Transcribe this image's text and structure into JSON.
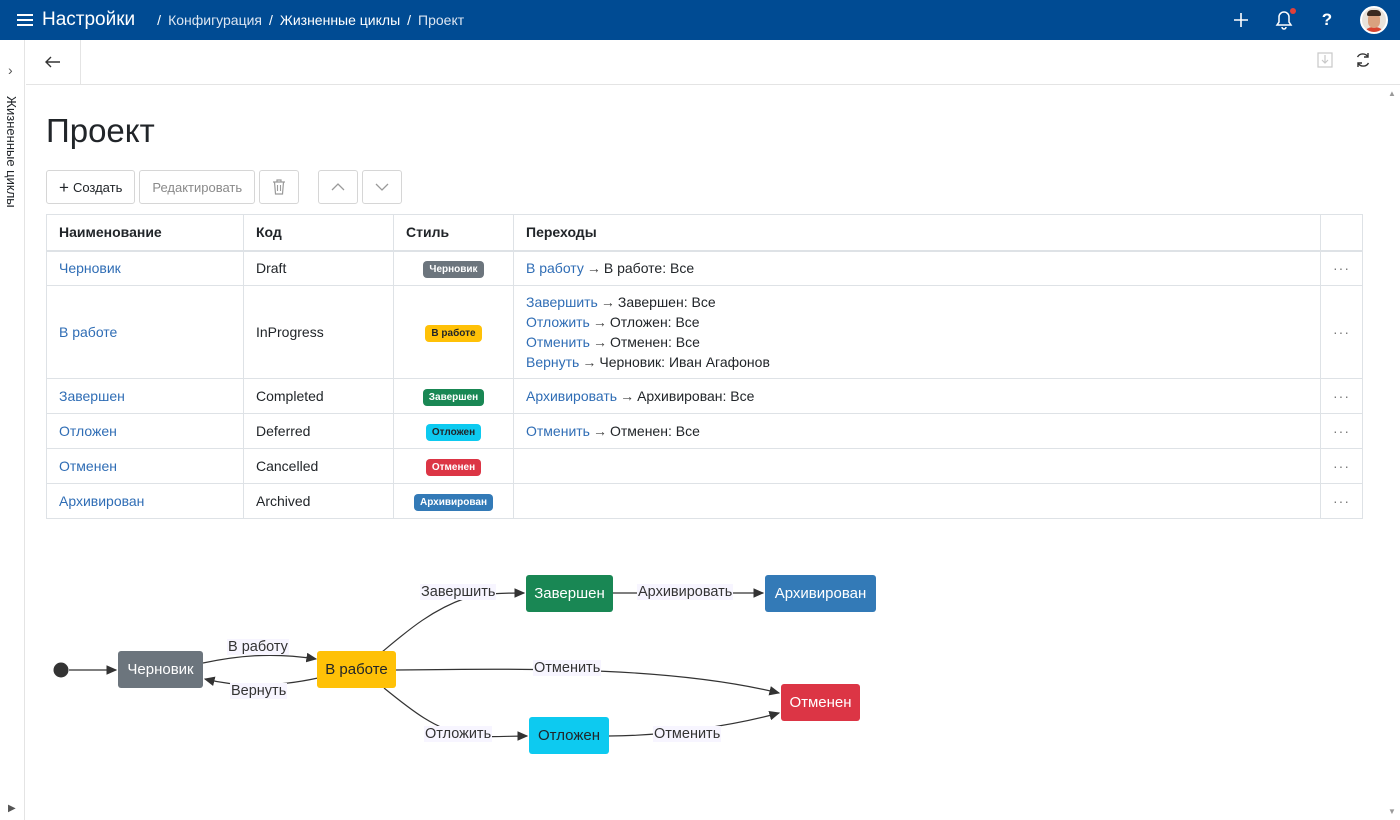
{
  "app": {
    "title": "Настройки"
  },
  "breadcrumbs": [
    "Конфигурация",
    "Жизненные циклы",
    "Проект"
  ],
  "sidebar": {
    "label": "Жизненные циклы"
  },
  "page": {
    "title": "Проект"
  },
  "toolbar": {
    "create": "Создать",
    "edit": "Редактировать"
  },
  "table": {
    "headers": [
      "Наименование",
      "Код",
      "Стиль",
      "Переходы"
    ],
    "rows": [
      {
        "name": "Черновик",
        "code": "Draft",
        "style": "Черновик",
        "style_color": "#6c757d",
        "style_text": "#ffffff",
        "transitions": [
          {
            "action": "В работу",
            "target": "В работе: Все"
          }
        ]
      },
      {
        "name": "В работе",
        "code": "InProgress",
        "style": "В работе",
        "style_color": "#ffc107",
        "style_text": "#212529",
        "transitions": [
          {
            "action": "Завершить",
            "target": "Завершен: Все"
          },
          {
            "action": "Отложить",
            "target": "Отложен: Все"
          },
          {
            "action": "Отменить",
            "target": "Отменен: Все"
          },
          {
            "action": "Вернуть",
            "target": "Черновик: Иван Агафонов"
          }
        ]
      },
      {
        "name": "Завершен",
        "code": "Completed",
        "style": "Завершен",
        "style_color": "#198754",
        "style_text": "#ffffff",
        "transitions": [
          {
            "action": "Архивировать",
            "target": "Архивирован: Все"
          }
        ]
      },
      {
        "name": "Отложен",
        "code": "Deferred",
        "style": "Отложен",
        "style_color": "#0dcaf0",
        "style_text": "#212529",
        "transitions": [
          {
            "action": "Отменить",
            "target": "Отменен: Все"
          }
        ]
      },
      {
        "name": "Отменен",
        "code": "Cancelled",
        "style": "Отменен",
        "style_color": "#dc3545",
        "style_text": "#ffffff",
        "transitions": []
      },
      {
        "name": "Архивирован",
        "code": "Archived",
        "style": "Архивирован",
        "style_color": "#337ab7",
        "style_text": "#ffffff",
        "transitions": []
      }
    ]
  },
  "diagram": {
    "nodes": {
      "draft": "Черновик",
      "inprogress": "В работе",
      "completed": "Завершен",
      "archived": "Архивирован",
      "cancelled": "Отменен",
      "deferred": "Отложен"
    },
    "edges": {
      "to_work": "В работу",
      "back": "Вернуть",
      "complete": "Завершить",
      "archive": "Архивировать",
      "cancel1": "Отменить",
      "defer": "Отложить",
      "cancel2": "Отменить"
    }
  }
}
